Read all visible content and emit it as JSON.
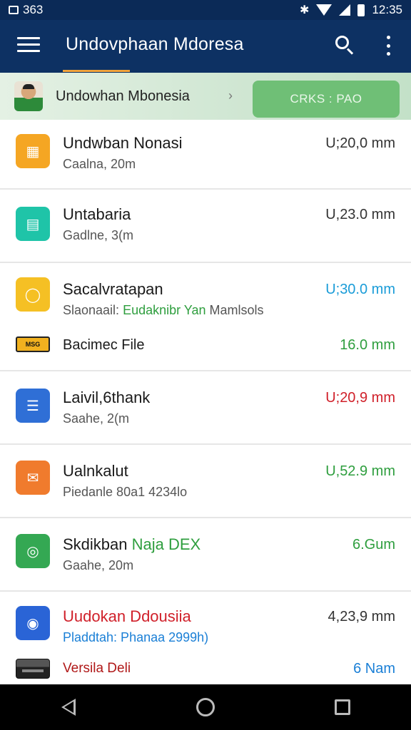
{
  "status_bar": {
    "left_text": "363",
    "time": "12:35",
    "icons": [
      "image-icon",
      "bluetooth-icon",
      "wifi-icon",
      "signal-icon",
      "battery-icon"
    ]
  },
  "app_bar": {
    "title": "Undovphaan Mdoresa",
    "accent_color": "#f0a23c",
    "background_color": "#0d3163"
  },
  "banner": {
    "text": "Undowhan Mbonesia",
    "chevron": "›",
    "action_label": "CRKS : PAO",
    "action_color": "#6fbf76"
  },
  "list": {
    "items": [
      {
        "title": "Undwban Nonasi",
        "subtitle": "Caalna, 20m",
        "size": "U;20,0 mm",
        "size_color": "#333333",
        "icon": "grid-icon",
        "icon_color": "#f5a623",
        "glyph": "▦"
      },
      {
        "title": "Untabaria",
        "subtitle": "Gadlne, 3(m",
        "size": "U,23.0 mm",
        "size_color": "#333333",
        "icon": "document-icon",
        "icon_color": "#1fc4a8",
        "glyph": "▤"
      },
      {
        "title": "Sacalvratapan",
        "subtitle_prefix": "Slaonaail: ",
        "subtitle_highlight": "Eudaknibr Yan",
        "subtitle_suffix": " Mamlsols",
        "size": "U;30.0 mm",
        "size_color": "#1a9cd8",
        "icon": "chat-icon",
        "icon_color": "#f5c024",
        "glyph": "◯",
        "sub_item": {
          "title": "Bacimec File",
          "size": "16.0 mm",
          "size_color": "#2e9e3e",
          "thumb_text": "MSG"
        }
      },
      {
        "title": "Laivil,6thank",
        "subtitle": "Saahe, 2(m",
        "size": "U;20,9 mm",
        "size_color": "#d0202a",
        "icon": "list-icon",
        "icon_color": "#2f6fd6",
        "glyph": "☰"
      },
      {
        "title": "Ualnkalut",
        "subtitle": "Piedanle 80a1 4234lo",
        "size": "U,52.9 mm",
        "size_color": "#2e9e3e",
        "icon": "mail-icon",
        "icon_color": "#f07b2d",
        "glyph": "✉"
      },
      {
        "title_prefix": "Skdikban ",
        "title_highlight": "Naja DEX",
        "subtitle": "Gaahe, 20m",
        "size": "6.Gum",
        "size_color": "#2e9e3e",
        "icon": "refresh-icon",
        "icon_color": "#34a853",
        "glyph": "◎"
      },
      {
        "title": "Uudokan Ddousiia",
        "title_color": "#d0202a",
        "subtitle": "Pladdtah: Phanaa 2999h)",
        "subtitle_color": "#1a7fd6",
        "size": "4,23,9 mm",
        "size_color": "#333333",
        "icon": "compass-icon",
        "icon_color": "#2a64d6",
        "glyph": "◉",
        "sub_item": {
          "title": "Versila Deli",
          "title_color": "#b01818",
          "size": "6 Nam",
          "size_color": "#1a7fd6"
        }
      }
    ]
  },
  "nav_bar": {
    "buttons": [
      "back-icon",
      "home-icon",
      "recents-icon"
    ]
  }
}
